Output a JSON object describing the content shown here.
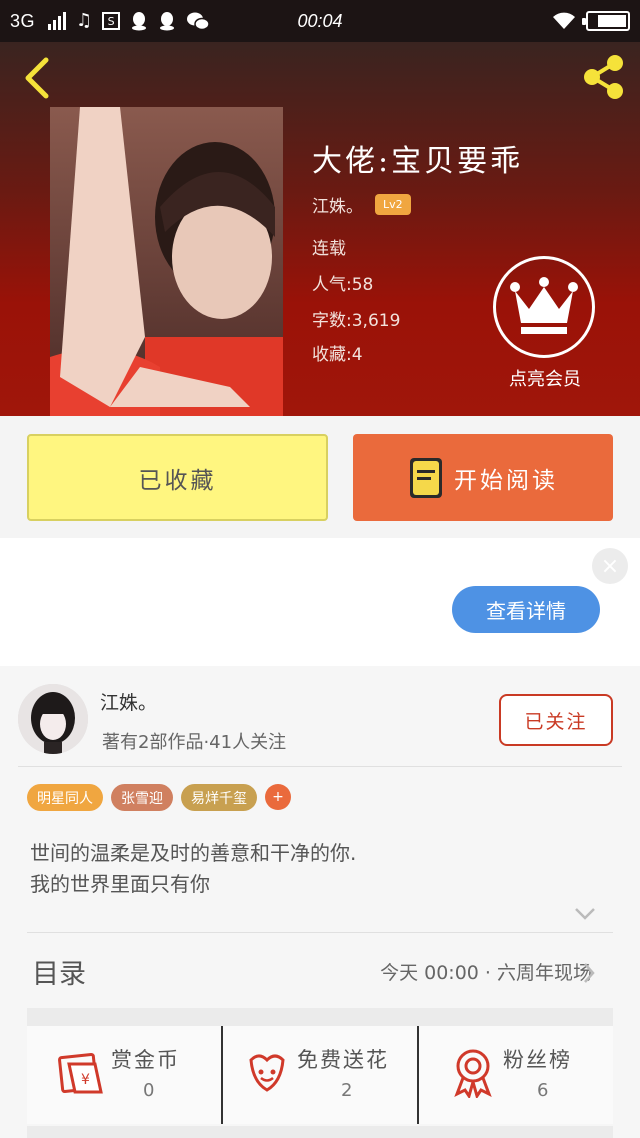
{
  "status_bar": {
    "network": "3G",
    "time": "00:04"
  },
  "book": {
    "title": "大佬:宝贝要乖",
    "author": "江姝。",
    "level": "Lv2",
    "status": "连载",
    "popularity_label": "人气:",
    "popularity": "58",
    "words_label": "字数:",
    "words": "3,619",
    "favorites_label": "收藏:",
    "favorites": "4"
  },
  "vip": {
    "label": "点亮会员"
  },
  "actions": {
    "favorited_label": "已收藏",
    "read_label": "开始阅读"
  },
  "ad": {
    "detail_label": "查看详情",
    "close_glyph": "×"
  },
  "author_card": {
    "name": "江姝。",
    "summary": "著有2部作品·41人关注",
    "follow_label": "已关注",
    "tags": [
      {
        "label": "明星同人",
        "color": "#f0a640"
      },
      {
        "label": "张雪迎",
        "color": "#d08060"
      },
      {
        "label": "易烊千玺",
        "color": "#c8a050"
      }
    ],
    "tag_more": "+",
    "description_lines": [
      "世间的温柔是及时的善意和干净的你.",
      "我的世界里面只有你"
    ]
  },
  "toc": {
    "label": "目录",
    "latest": "今天 00:00 · 六周年现场"
  },
  "stats": [
    {
      "label": "赏金币",
      "value": "0",
      "icon": "red-envelope-icon"
    },
    {
      "label": "免费送花",
      "value": "2",
      "icon": "flower-icon"
    },
    {
      "label": "粉丝榜",
      "value": "6",
      "icon": "medal-icon"
    }
  ],
  "colors": {
    "accent": "#ea6a3c",
    "favorite_bg": "#fff680",
    "follow_red": "#c93a24",
    "detail_blue": "#4e92e4"
  }
}
